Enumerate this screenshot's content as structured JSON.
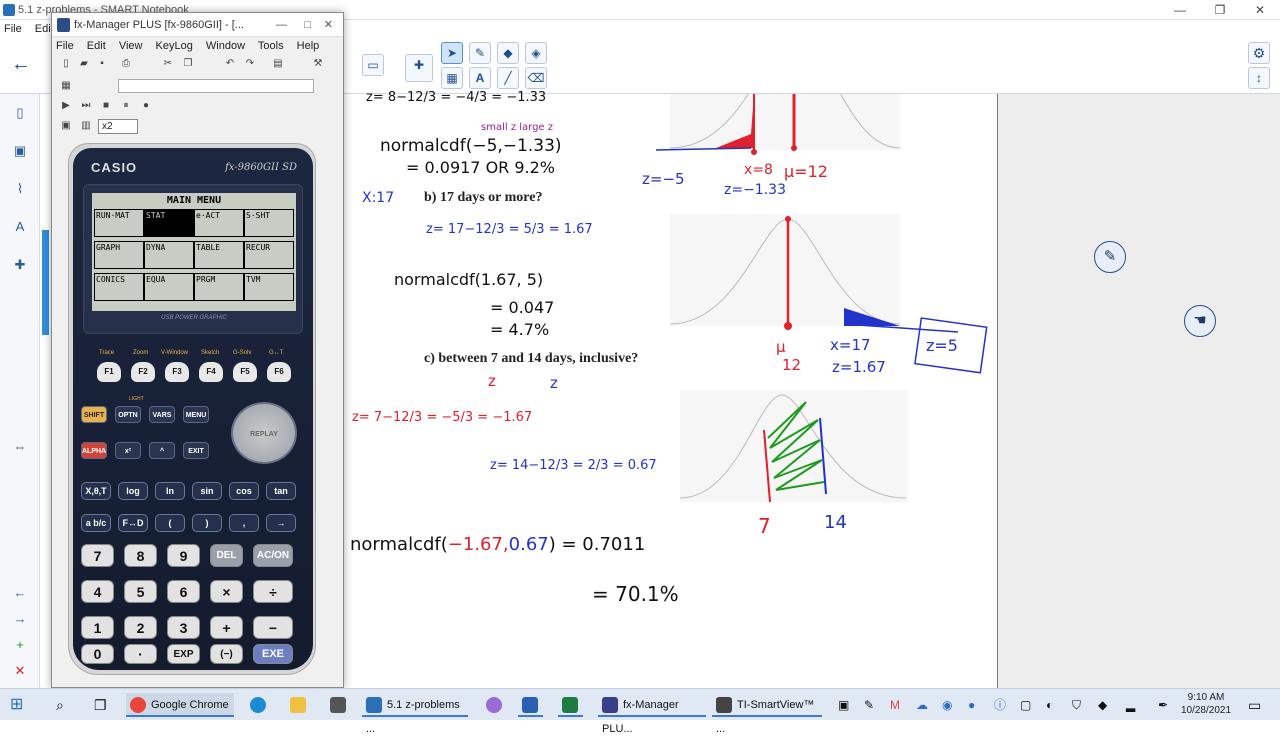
{
  "notebook": {
    "title": "5.1 z-problems - SMART Notebook",
    "menu": [
      "File",
      "Edit"
    ],
    "window_controls": [
      "—",
      "❐",
      "✕"
    ]
  },
  "fxm": {
    "title": "fx-Manager PLUS [fx-9860GII] - [...",
    "menu": [
      "File",
      "Edit",
      "View",
      "KeyLog",
      "Window",
      "Tools",
      "Help"
    ],
    "zoom": "x2",
    "calc_brand": "CASIO",
    "calc_model": "fx-9860GII SD",
    "usb_label": "USB POWER GRAPHIC",
    "screen_title": "MAIN MENU",
    "menu_cells": [
      "RUN·MAT",
      "STAT",
      "e·ACT",
      "S·SHT",
      "GRAPH",
      "DYNA",
      "TABLE",
      "RECUR",
      "CONICS",
      "EQUA",
      "PRGM",
      "TVM"
    ],
    "fn_labels": [
      "Trace",
      "Zoom",
      "V-Window",
      "Sketch",
      "G-Solv",
      "G↔T"
    ],
    "fn_keys": [
      "F1",
      "F2",
      "F3",
      "F4",
      "F5",
      "F6"
    ],
    "row1": [
      "SHIFT",
      "OPTN",
      "VARS",
      "MENU"
    ],
    "row2": [
      "ALPHA",
      "x²",
      "^",
      "EXIT"
    ],
    "replay": "REPLAY",
    "light": "LIGHT",
    "row3": [
      "X,θ,T",
      "log",
      "ln",
      "sin",
      "cos",
      "tan"
    ],
    "row4": [
      "a b/c",
      "F↔D",
      "(",
      ")",
      ",",
      "→"
    ],
    "num1": [
      "7",
      "8",
      "9",
      "DEL",
      "AC/ON"
    ],
    "num2": [
      "4",
      "5",
      "6",
      "×",
      "÷"
    ],
    "num3": [
      "1",
      "2",
      "3",
      "+",
      "−"
    ],
    "num4": [
      "0",
      "·",
      "EXP",
      "(−)",
      "EXE"
    ]
  },
  "notes": {
    "l1": "z= 8−12/3 = −4/3 = −1.33",
    "small_large": "small z     large z",
    "l2": "normalcdf(−5,−1.33)",
    "l3": "= 0.0917  OR  9.2%",
    "qb_mark": "X:17",
    "qb": "b)  17 days or more?",
    "l4": "z= 17−12/3 = 5/3 = 1.67",
    "l5": "normalcdf(1.67, 5)",
    "l6": "= 0.047",
    "l7": "= 4.7%",
    "qc": "c)  between 7 and 14 days, inclusive?",
    "qc_z1": "z",
    "qc_z2": "z",
    "l8": "z= 7−12/3 = −5/3 = −1.67",
    "l9": "z= 14−12/3 = 2/3 = 0.67",
    "l10_a": "normalcdf(",
    "l10_b": "−1.67,",
    "l10_c": "0.67",
    "l10_d": ") = 0.7011",
    "l11": "= 70.1%",
    "g1_z": "z=−5",
    "g1_x": "x=8",
    "g1_mu": "μ=12",
    "g1_z2": "z=−1.33",
    "g2_mu": "μ",
    "g2_12": "12",
    "g2_x": "x=17",
    "g2_z": "z=1.67",
    "g2_box": "z=5",
    "g3_7": "7",
    "g3_14": "14"
  },
  "taskbar": {
    "items": [
      "Google Chrome",
      "5.1 z-problems ...",
      "fx-Manager PLU...",
      "TI-SmartView™ ..."
    ],
    "time": "9:10 AM",
    "date": "10/28/2021"
  },
  "colors": {
    "accent": "#2f8fe0",
    "red_ink": "#e0202a",
    "blue_ink": "#2233cc",
    "green_ink": "#1e9a1e"
  }
}
